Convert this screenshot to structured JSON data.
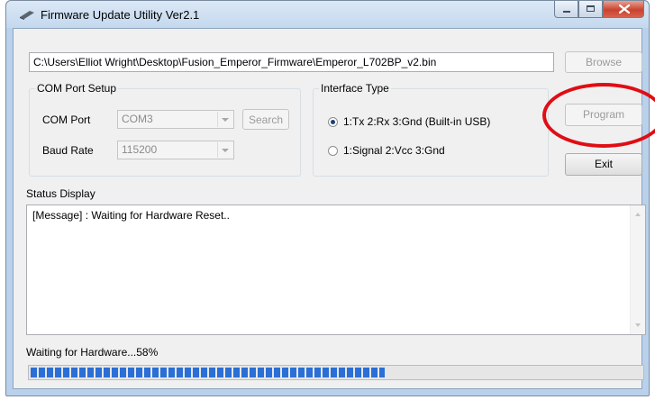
{
  "window": {
    "title": "Firmware Update Utility Ver2.1"
  },
  "file": {
    "path": "C:\\Users\\Elliot Wright\\Desktop\\Fusion_Emperor_Firmware\\Emperor_L702BP_v2.bin",
    "browse_label": "Browse"
  },
  "com_setup": {
    "title": "COM Port Setup",
    "port_label": "COM Port",
    "port_value": "COM3",
    "search_label": "Search",
    "baud_label": "Baud Rate",
    "baud_value": "115200"
  },
  "interface": {
    "title": "Interface Type",
    "option1": "1:Tx 2:Rx 3:Gnd (Built-in USB)",
    "option2": "1:Signal 2:Vcc 3:Gnd",
    "selected": "option1"
  },
  "actions": {
    "program_label": "Program",
    "exit_label": "Exit"
  },
  "status": {
    "title": "Status Display",
    "message": "[Message] : Waiting for Hardware Reset..",
    "progress_text": "Waiting for Hardware...58%",
    "progress": 0.58
  },
  "colors": {
    "progress_fill": "#2a6fd6",
    "highlight": "#e00d14"
  }
}
